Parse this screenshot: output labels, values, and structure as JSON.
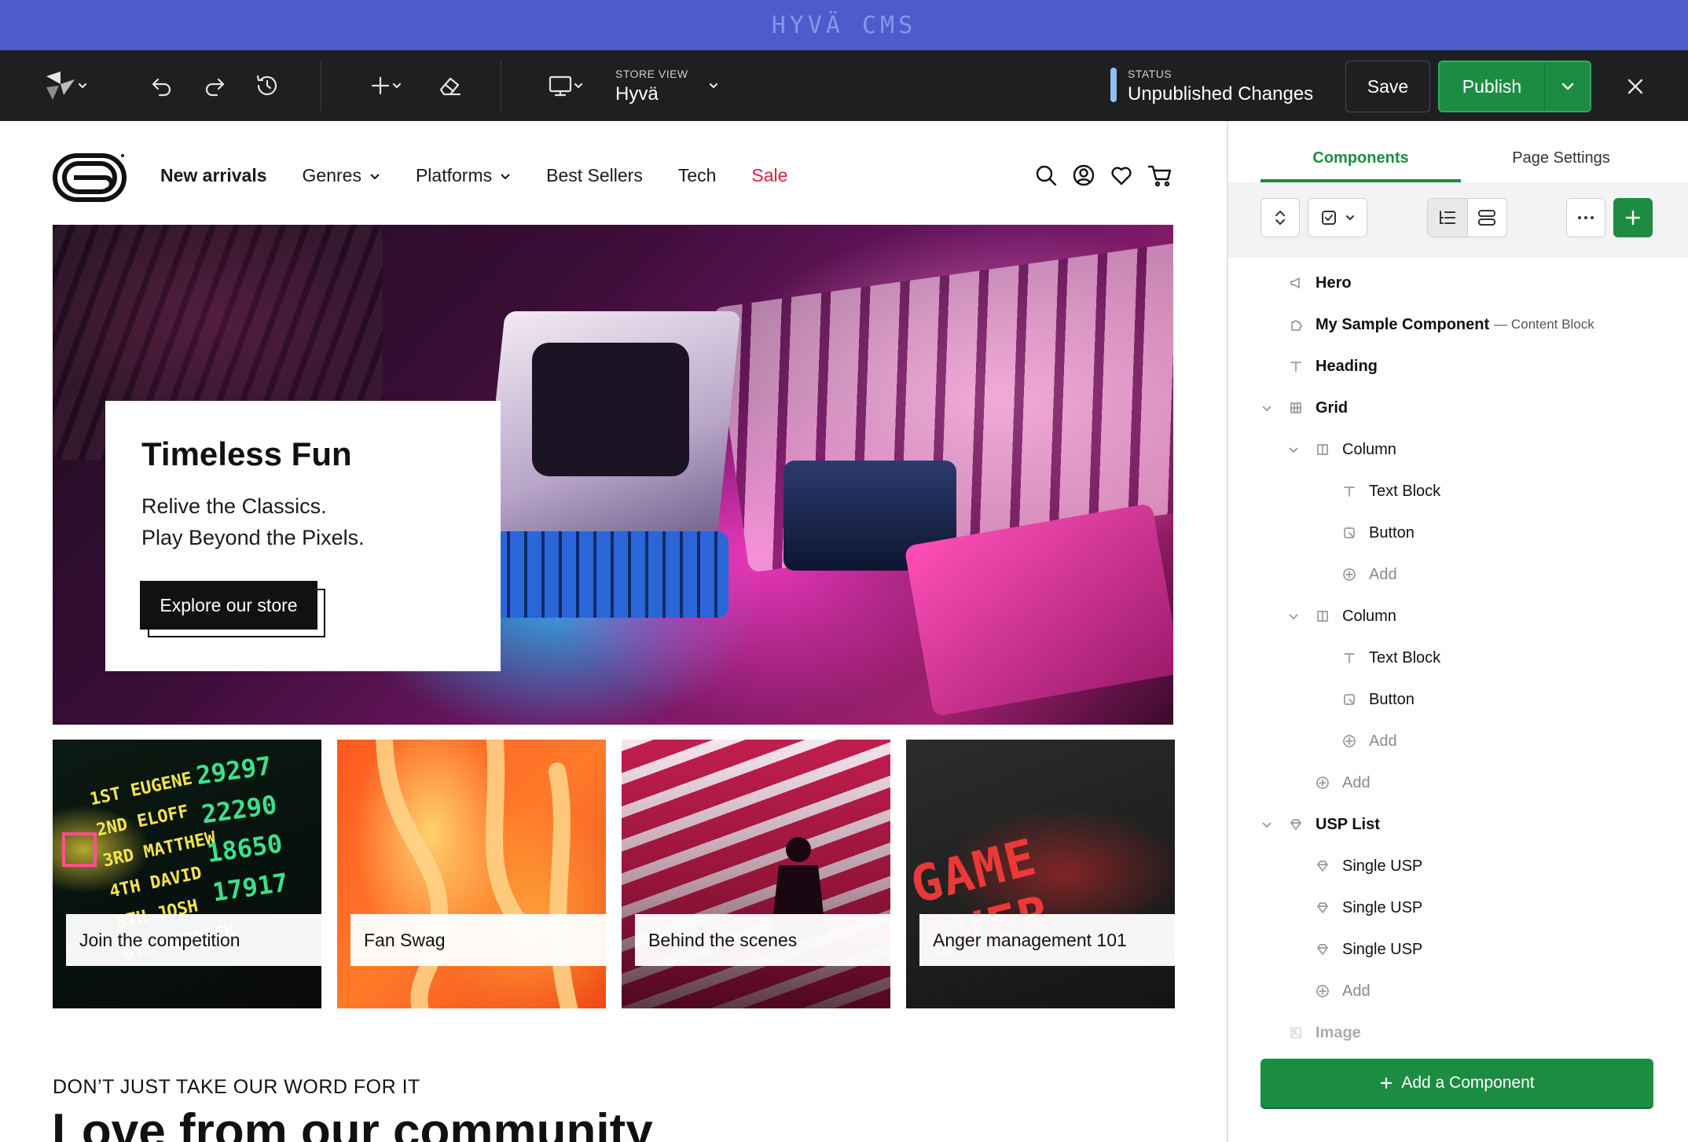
{
  "window": {
    "title": "HYVÄ CMS"
  },
  "toolbar": {
    "store_view_label": "STORE VIEW",
    "store_view_value": "Hyvä",
    "status_label": "STATUS",
    "status_value": "Unpublished Changes",
    "save_label": "Save",
    "publish_label": "Publish"
  },
  "store": {
    "nav": [
      {
        "label": "New arrivals",
        "style": "bold"
      },
      {
        "label": "Genres",
        "dropdown": true
      },
      {
        "label": "Platforms",
        "dropdown": true
      },
      {
        "label": "Best Sellers"
      },
      {
        "label": "Tech"
      },
      {
        "label": "Sale",
        "color": "#d71f3d"
      }
    ],
    "hero": {
      "title": "Timeless Fun",
      "line1": "Relive the Classics.",
      "line2": "Play Beyond the Pixels.",
      "cta": "Explore our store"
    },
    "tiles": [
      {
        "label": "Join the competition"
      },
      {
        "label": "Fan Swag"
      },
      {
        "label": "Behind the scenes"
      },
      {
        "label": "Anger management 101",
        "image_text": "GAME OVER"
      }
    ],
    "testimonial": {
      "subtitle": "DON’T JUST TAKE OUR WORD FOR IT",
      "title": "Love from our community"
    }
  },
  "panel": {
    "tabs": [
      {
        "label": "Components",
        "active": true
      },
      {
        "label": "Page Settings",
        "active": false
      }
    ],
    "tree": [
      {
        "label": "Hero",
        "icon": "megaphone-icon",
        "bold": true
      },
      {
        "label": "My Sample Component",
        "sub": "— Content Block",
        "icon": "puzzle-icon",
        "bold": true
      },
      {
        "label": "Heading",
        "icon": "text-icon",
        "bold": true
      },
      {
        "label": "Grid",
        "icon": "grid-icon",
        "bold": true,
        "expanded": true
      },
      {
        "label": "Column",
        "icon": "column-icon",
        "expanded": true
      },
      {
        "label": "Text Block",
        "icon": "text-icon"
      },
      {
        "label": "Button",
        "icon": "button-icon"
      },
      {
        "label": "Add",
        "icon": "plus-icon",
        "add": true
      },
      {
        "label": "Column",
        "icon": "column-icon",
        "expanded": true
      },
      {
        "label": "Text Block",
        "icon": "text-icon"
      },
      {
        "label": "Button",
        "icon": "button-icon"
      },
      {
        "label": "Add",
        "icon": "plus-icon",
        "add": true
      },
      {
        "label": "Add",
        "icon": "plus-icon",
        "add": true
      },
      {
        "label": "USP List",
        "icon": "diamond-icon",
        "bold": true,
        "expanded": true
      },
      {
        "label": "Single USP",
        "icon": "diamond-icon"
      },
      {
        "label": "Single USP",
        "icon": "diamond-icon"
      },
      {
        "label": "Single USP",
        "icon": "diamond-icon"
      },
      {
        "label": "Add",
        "icon": "plus-icon",
        "add": true
      },
      {
        "label": "Image",
        "icon": "image-icon",
        "bold": true
      }
    ],
    "add_component_label": "Add a Component"
  },
  "colors": {
    "titlebar": "#4d5ccc",
    "toolbar": "#1e1f21",
    "accent_green": "#1d8c43",
    "sale_red": "#d71f3d",
    "status_indicator": "#8ec0ef"
  }
}
